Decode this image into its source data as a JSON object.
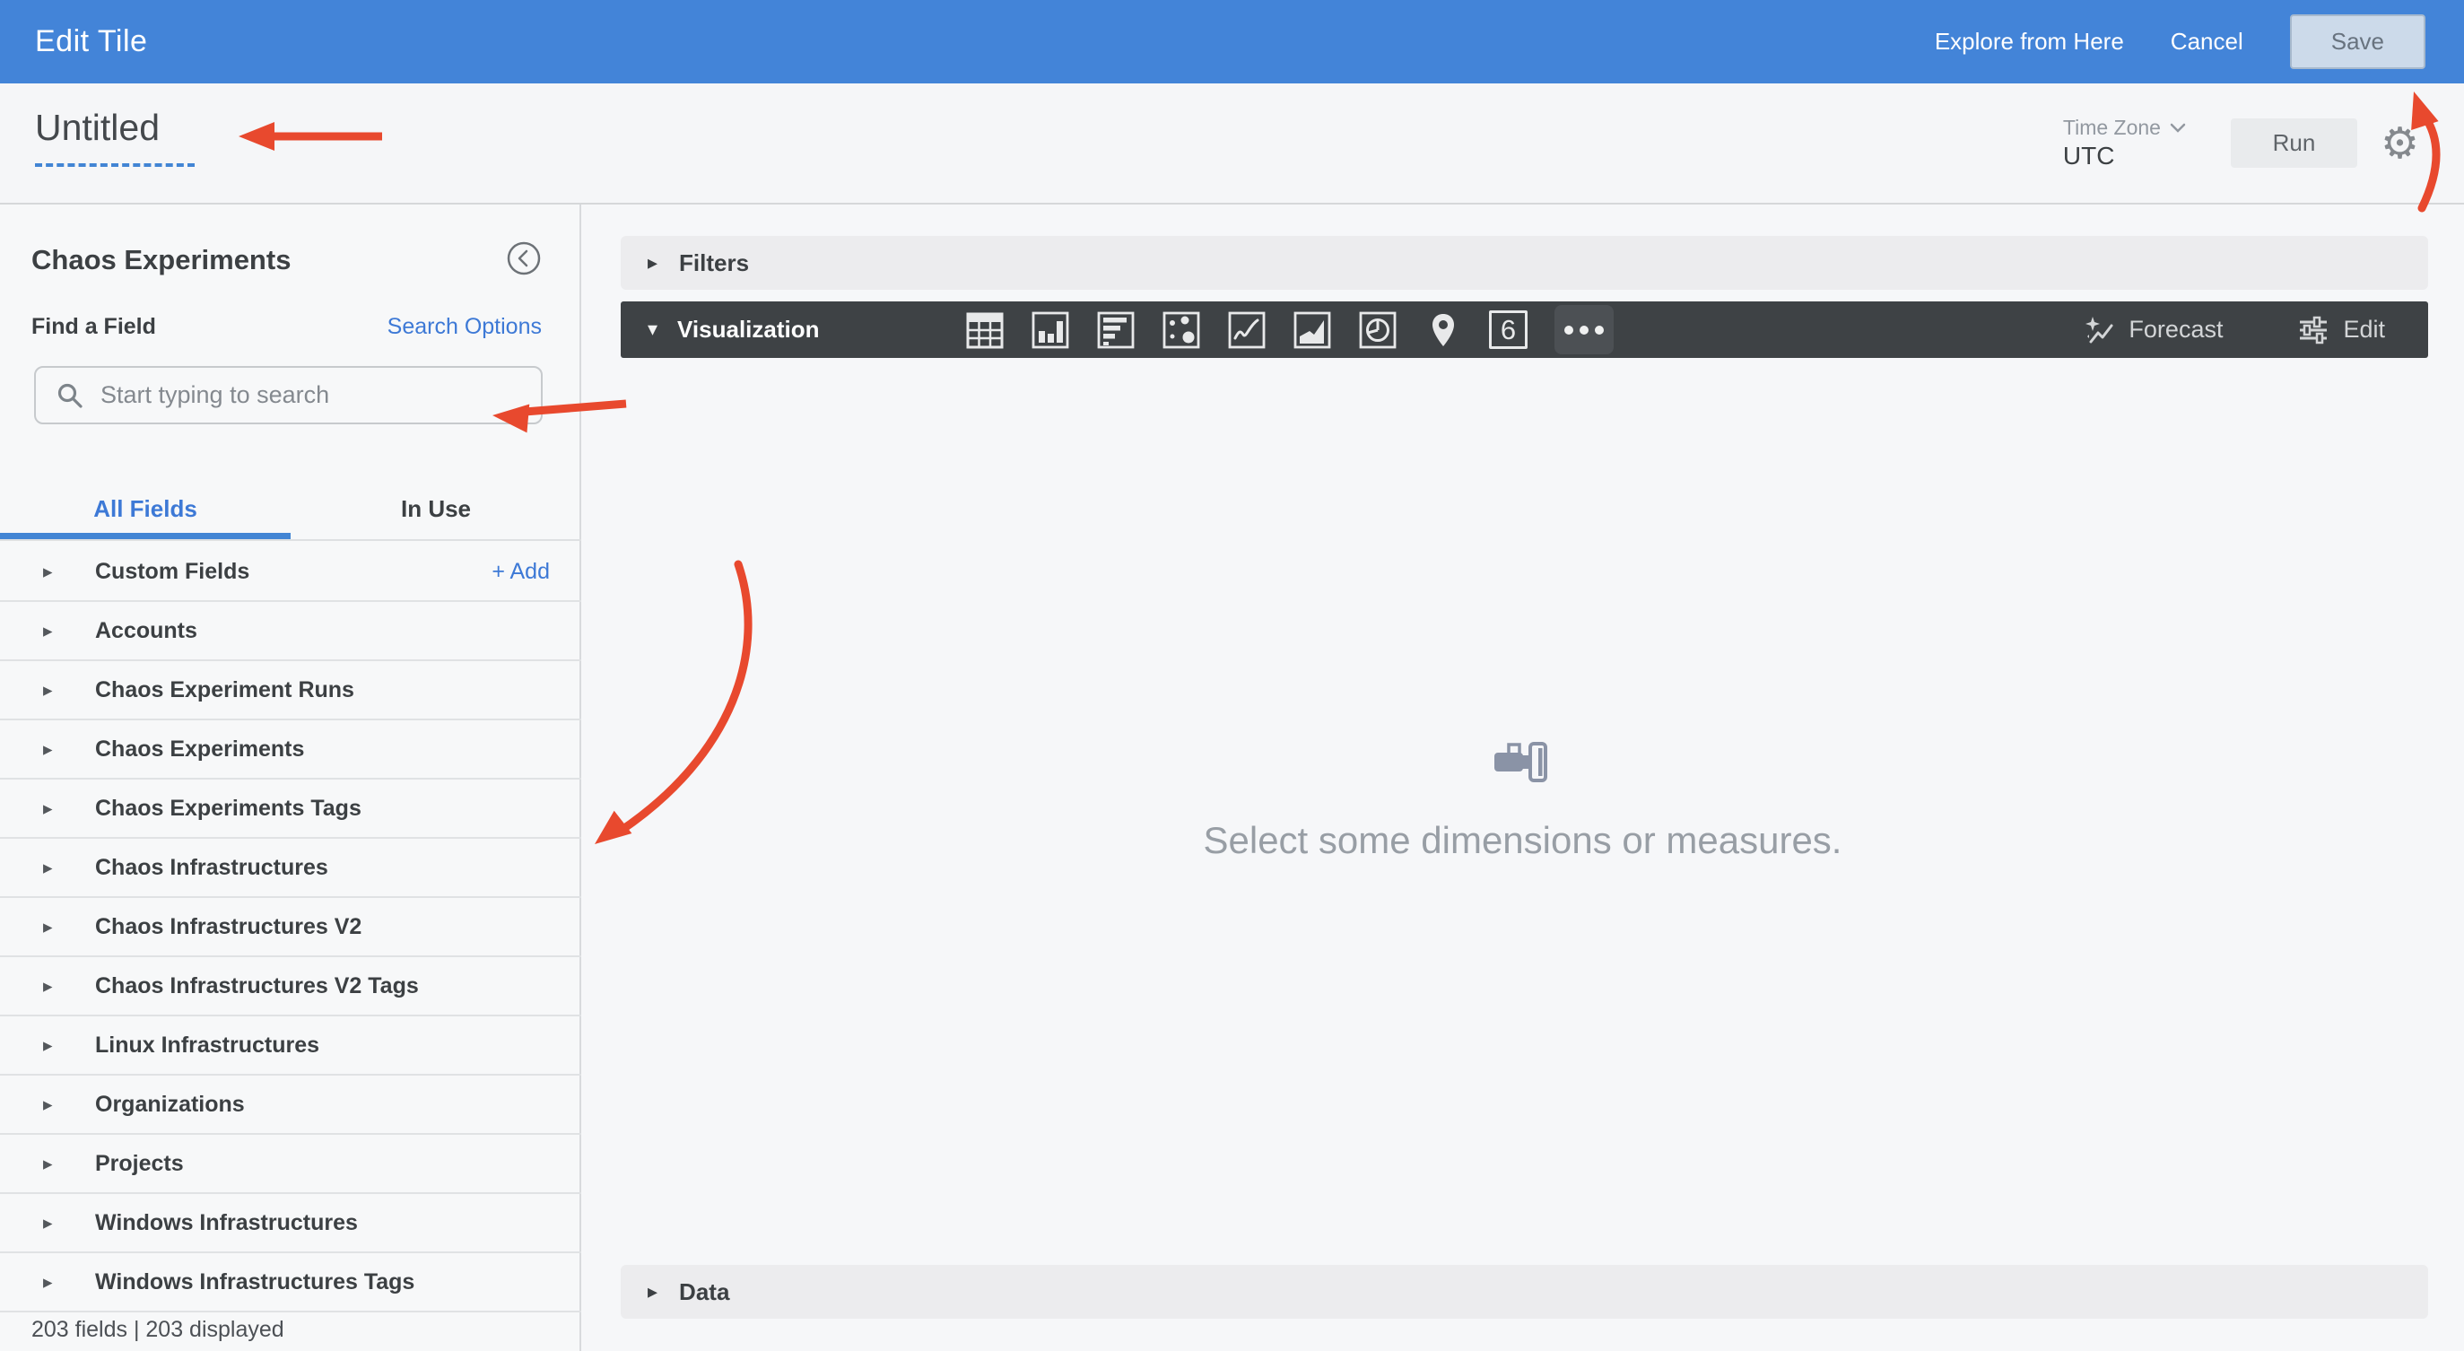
{
  "colors": {
    "header_blue": "#4384d8",
    "accent_blue": "#3d79d6",
    "dashed_underline_blue": "#4285d4",
    "dark_bar": "#3e4245",
    "annotation_red": "#e8492e",
    "text_dark": "#3c4043",
    "save_button_bg": "#ccdaea"
  },
  "header": {
    "title": "Edit Tile",
    "explore": "Explore from Here",
    "cancel": "Cancel",
    "save": "Save"
  },
  "toolbar": {
    "tile_title": "Untitled",
    "timezone_label": "Time Zone",
    "timezone_value": "UTC",
    "run": "Run"
  },
  "sidebar": {
    "title": "Chaos Experiments",
    "find_label": "Find a Field",
    "search_options": "Search Options",
    "search_placeholder": "Start typing to search",
    "tabs": {
      "all": "All Fields",
      "in_use": "In Use"
    },
    "custom_fields_action": "+ Add",
    "groups": [
      {
        "label": "Custom Fields"
      },
      {
        "label": "Accounts"
      },
      {
        "label": "Chaos Experiment Runs"
      },
      {
        "label": "Chaos Experiments"
      },
      {
        "label": "Chaos Experiments Tags"
      },
      {
        "label": "Chaos Infrastructures"
      },
      {
        "label": "Chaos Infrastructures V2"
      },
      {
        "label": "Chaos Infrastructures V2 Tags"
      },
      {
        "label": "Linux Infrastructures"
      },
      {
        "label": "Organizations"
      },
      {
        "label": "Projects"
      },
      {
        "label": "Windows Infrastructures"
      },
      {
        "label": "Windows Infrastructures Tags"
      }
    ],
    "footer": "203 fields | 203 displayed"
  },
  "main": {
    "filters": "Filters",
    "visualization": "Visualization",
    "viz_icons": [
      "table",
      "column-chart",
      "bar-chart",
      "scatter",
      "line-chart",
      "area-chart",
      "pie-chart",
      "map-pin",
      "single-value",
      "more"
    ],
    "single_value_glyph": "6",
    "forecast": "Forecast",
    "edit": "Edit",
    "empty_state": "Select some dimensions or measures.",
    "data": "Data"
  }
}
